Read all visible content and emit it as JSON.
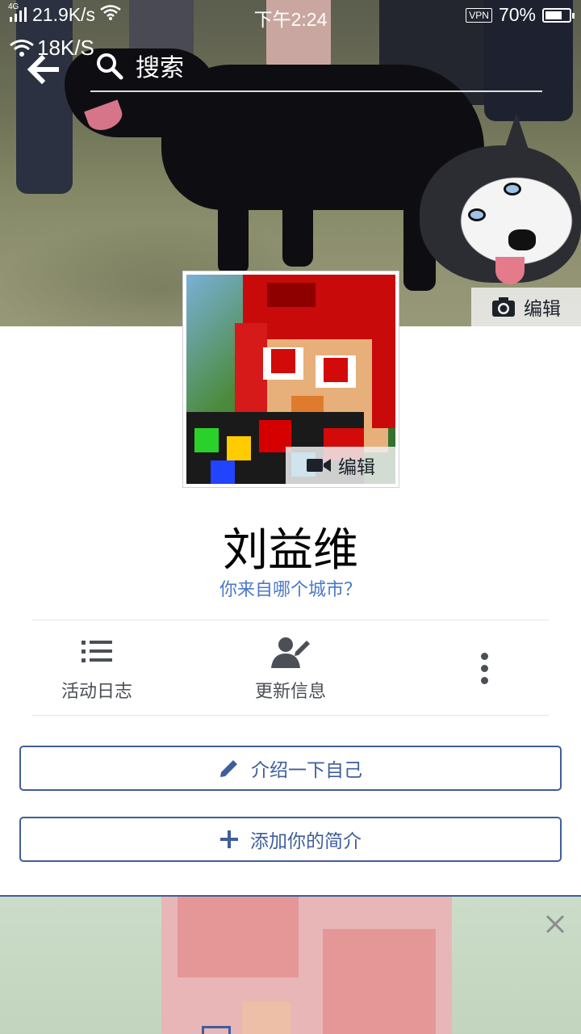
{
  "status_bar": {
    "network": "4G",
    "speed": "21.9K/s",
    "time": "下午2:24",
    "vpn": "VPN",
    "battery": "70%",
    "battery_level": 0.7,
    "wifi_speed": "18K/S"
  },
  "header": {
    "search_placeholder": "搜索",
    "back_icon": "back-arrow-icon",
    "search_icon": "search-icon"
  },
  "cover": {
    "edit_label": "编辑",
    "edit_icon": "camera-icon"
  },
  "avatar": {
    "edit_label": "编辑",
    "edit_icon": "video-camera-icon"
  },
  "profile": {
    "name": "刘益维",
    "city_prompt": "你来自哪个城市？"
  },
  "actions": [
    {
      "label": "活动日志",
      "icon": "list-icon"
    },
    {
      "label": "更新信息",
      "icon": "edit-profile-icon"
    },
    {
      "label": "",
      "icon": "more-vertical-icon"
    }
  ],
  "buttons": {
    "intro_label": "介绍一下自己",
    "intro_icon": "pencil-icon",
    "bio_label": "添加你的简介",
    "bio_icon": "plus-icon"
  },
  "colors": {
    "accent": "#3f5e9a",
    "link": "#4a78c9",
    "icon_gray": "#4b4f56"
  }
}
